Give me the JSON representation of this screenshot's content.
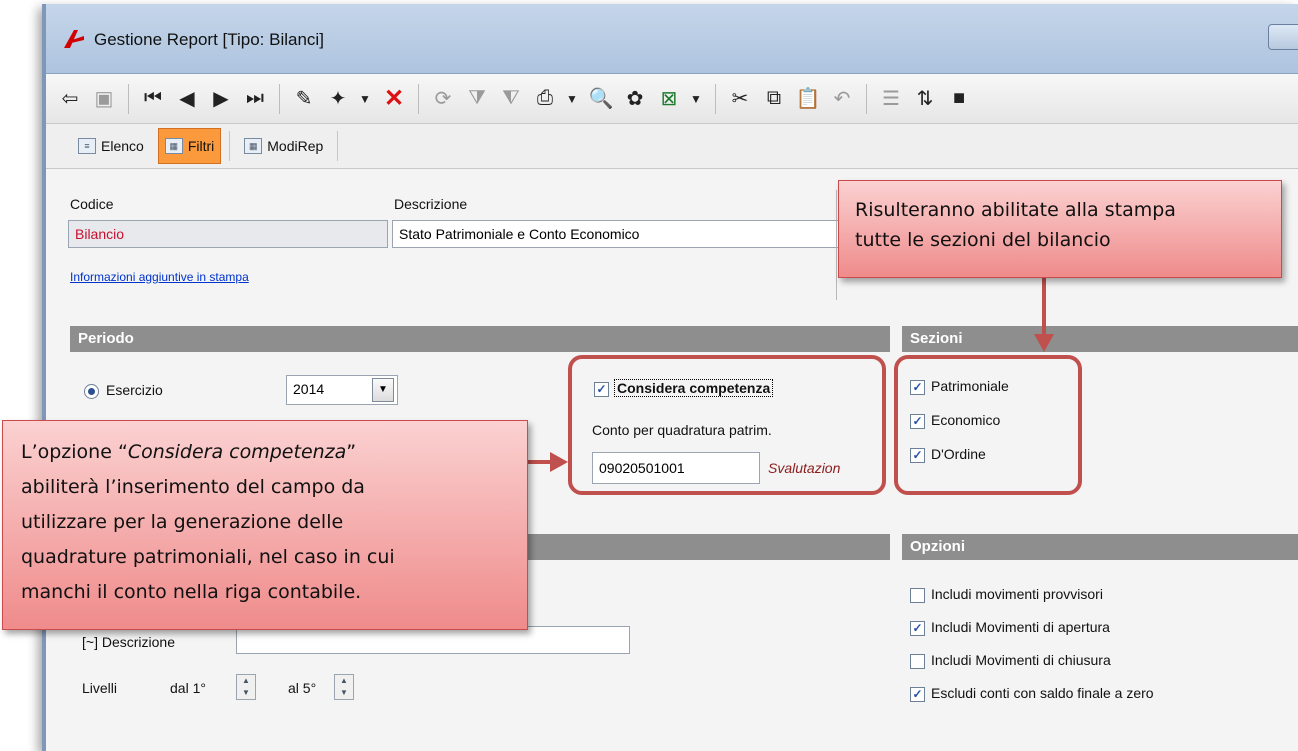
{
  "window": {
    "title": "Gestione Report [Tipo: Bilanci]"
  },
  "tabs": [
    {
      "label": "Elenco"
    },
    {
      "label": "Filtri"
    },
    {
      "label": "ModiRep"
    }
  ],
  "header": {
    "codice_label": "Codice",
    "codice_value": "Bilancio",
    "descrizione_label": "Descrizione",
    "descrizione_value": "Stato Patrimoniale e Conto Economico",
    "info_link": "Informazioni aggiuntive in stampa"
  },
  "periodo": {
    "title": "Periodo",
    "esercizio_label": "Esercizio",
    "esercizio_value": "2014",
    "competenza_label": "Considera competenza",
    "competenza_checked": true,
    "conto_label": "Conto per quadratura patrim.",
    "conto_value": "09020501001",
    "conto_desc": "Svalutazion"
  },
  "sezioni": {
    "title": "Sezioni",
    "items": [
      {
        "label": "Patrimoniale",
        "checked": true
      },
      {
        "label": "Economico",
        "checked": true
      },
      {
        "label": "D'Ordine",
        "checked": true
      }
    ]
  },
  "conti": {
    "descrizione_label": "[~] Descrizione",
    "descrizione_value": "",
    "livelli_label": "Livelli",
    "dal_label": "dal 1°",
    "al_label": "al 5°"
  },
  "opzioni": {
    "title": "Opzioni",
    "items": [
      {
        "label": "Includi movimenti provvisori",
        "checked": false
      },
      {
        "label": "Includi Movimenti di apertura",
        "checked": true
      },
      {
        "label": "Includi Movimenti di chiusura",
        "checked": false
      },
      {
        "label": "Escludi conti con saldo finale a zero",
        "checked": true
      }
    ]
  },
  "callouts": {
    "sezioni_line1": "Risulteranno abilitate alla stampa",
    "sezioni_line2": "tutte le sezioni del bilancio",
    "comp_l1_pre": "L’opzione “",
    "comp_l1_em": "Considera competenza",
    "comp_l1_post": "”",
    "comp_l2": "abiliterà l’inserimento del campo da",
    "comp_l3": "utilizzare per la generazione delle",
    "comp_l4": "quadrature patrimoniali, nel caso in cui",
    "comp_l5": "manchi il conto nella riga contabile."
  },
  "colors": {
    "accent_tab": "#fb9a3c",
    "section_header": "#8e8e8e",
    "callout_fill": "#ef8b8b",
    "highlight": "#c0504d"
  }
}
